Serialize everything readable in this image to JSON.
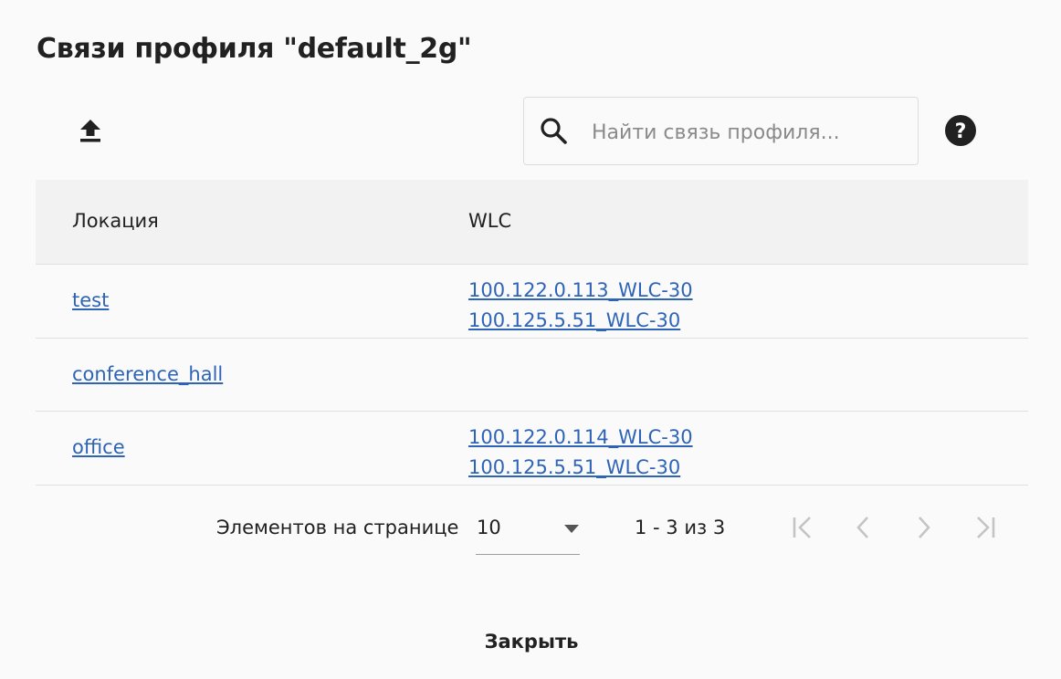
{
  "dialog": {
    "title": "Связи профиля \"default_2g\"",
    "close_label": "Закрыть"
  },
  "toolbar": {
    "upload_icon": "upload-icon",
    "help_icon": "help-icon"
  },
  "search": {
    "placeholder": "Найти связь профиля...",
    "value": "",
    "icon": "search-icon"
  },
  "table": {
    "columns": [
      "Локация",
      "WLC"
    ],
    "rows": [
      {
        "location": "test",
        "wlc": [
          "100.122.0.113_WLC-30",
          "100.125.5.51_WLC-30"
        ]
      },
      {
        "location": "conference_hall",
        "wlc": []
      },
      {
        "location": "office",
        "wlc": [
          "100.122.0.114_WLC-30",
          "100.125.5.51_WLC-30"
        ]
      }
    ]
  },
  "paginator": {
    "items_per_page_label": "Элементов на странице",
    "page_size": "10",
    "range_label": "1 - 3 из 3",
    "buttons": [
      "first-page-icon",
      "previous-page-icon",
      "next-page-icon",
      "last-page-icon"
    ]
  },
  "colors": {
    "link": "#2e64b8",
    "header_bg": "#f2f2f2",
    "disabled": "#c4c4c4"
  }
}
